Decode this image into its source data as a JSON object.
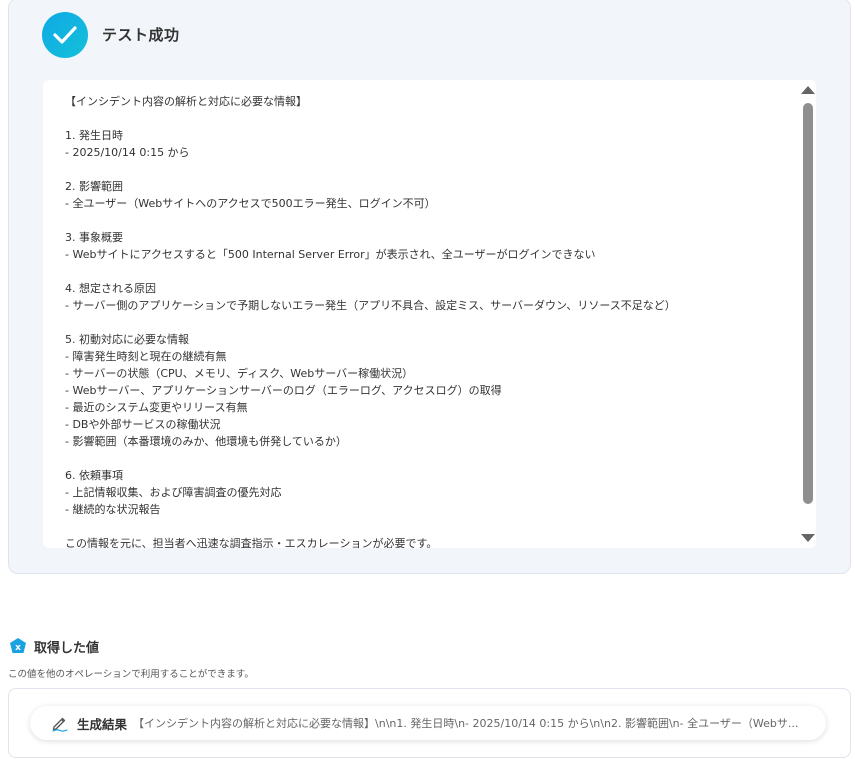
{
  "test_result": {
    "title": "テスト成功",
    "icon": "check-icon",
    "accent_color": "#11b4e0",
    "output_text": "【インシデント内容の解析と対応に必要な情報】\n\n1. 発生日時\n- 2025/10/14 0:15 から\n\n2. 影響範囲\n- 全ユーザー（Webサイトへのアクセスで500エラー発生、ログイン不可）\n\n3. 事象概要\n- Webサイトにアクセスすると「500 Internal Server Error」が表示され、全ユーザーがログインできない\n\n4. 想定される原因\n- サーバー側のアプリケーションで予期しないエラー発生（アプリ不具合、設定ミス、サーバーダウン、リソース不足など）\n\n5. 初動対応に必要な情報\n- 障害発生時刻と現在の継続有無\n- サーバーの状態（CPU、メモリ、ディスク、Webサーバー稼働状況）\n- Webサーバー、アプリケーションサーバーのログ（エラーログ、アクセスログ）の取得\n- 最近のシステム変更やリリース有無\n- DBや外部サービスの稼働状況\n- 影響範囲（本番環境のみか、他環境も併発しているか）\n\n6. 依頼事項\n- 上記情報収集、および障害調査の優先対応\n- 継続的な状況報告\n\nこの情報を元に、担当者へ迅速な調査指示・エスカレーションが必要です。"
  },
  "acquired": {
    "title": "取得した値",
    "description": "この値を他のオペレーションで利用することができます。",
    "icon": "variable-x-icon",
    "items": [
      {
        "label": "生成結果",
        "icon": "pen-icon",
        "value": "【インシデント内容の解析と対応に必要な情報】\\n\\n1. 発生日時\\n- 2025/10/14 0:15 から\\n\\n2. 影響範囲\\n- 全ユーザー（Webサ..."
      }
    ]
  }
}
